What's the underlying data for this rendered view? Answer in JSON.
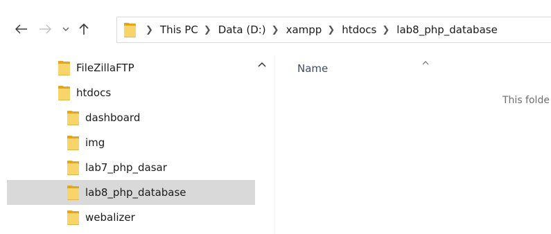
{
  "navigation": {
    "back_icon": "back-arrow-icon",
    "forward_icon": "forward-arrow-icon",
    "recent_icon": "chevron-down-icon",
    "up_icon": "up-arrow-icon"
  },
  "address_bar": {
    "crumbs": [
      "This PC",
      "Data (D:)",
      "xampp",
      "htdocs",
      "lab8_php_database"
    ]
  },
  "tree": {
    "items": [
      {
        "label": "FileZillaFTP"
      },
      {
        "label": "htdocs"
      },
      {
        "label": "dashboard"
      },
      {
        "label": "img"
      },
      {
        "label": "lab7_php_dasar"
      },
      {
        "label": "lab8_php_database"
      },
      {
        "label": "webalizer"
      }
    ],
    "selected": "lab8_php_database"
  },
  "content": {
    "column_name": "Name",
    "empty_message": "This folde"
  },
  "colors": {
    "folder_back": "#e3a51a",
    "folder_front": "#f7d56b",
    "selection": "#d9d9d9",
    "column_header": "#3c4d6b"
  }
}
